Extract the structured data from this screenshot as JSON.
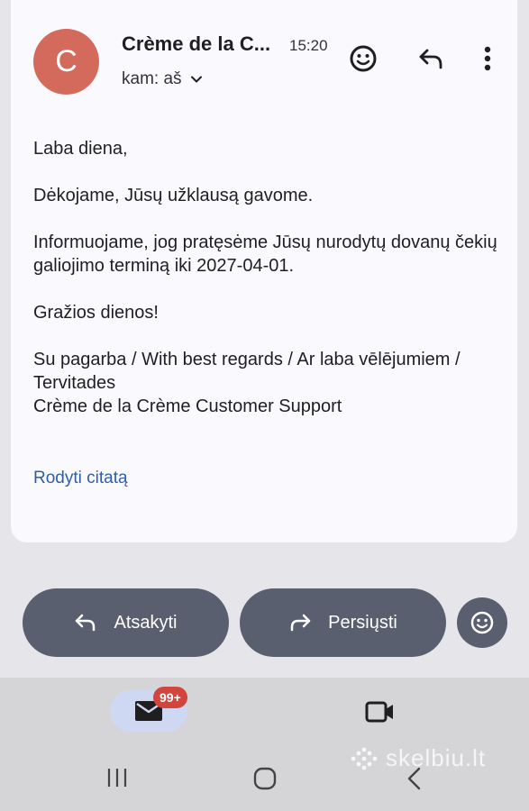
{
  "header": {
    "avatar_letter": "C",
    "sender": "Crème de la C...",
    "time": "15:20",
    "recipient": "kam: aš",
    "icons": [
      "add-reaction-icon",
      "reply-icon",
      "more-vert-icon",
      "chevron-down-icon"
    ]
  },
  "email": {
    "greeting": "Laba diena,",
    "line1": "Dėkojame, Jūsų užklausą gavome.",
    "line2": "Informuojame, jog pratęsėme Jūsų nurodytų dovanų čekių galiojimo terminą iki 2027-04-01.",
    "line3": "Gražios dienos!",
    "signature1": "Su pagarba / With best regards / Ar laba vēlējumiem / Tervitades",
    "signature2": "Crème de la Crème Customer Support",
    "show_quote": "Rodyti citatą"
  },
  "actions": {
    "reply": "Atsakyti",
    "forward": "Persiųsti"
  },
  "bottom_nav": {
    "mail_badge": "99+",
    "watermark": "skelbiu.lt"
  },
  "colors": {
    "avatar": "#d36a5c",
    "action_pill": "#5a5f70",
    "link": "#2f5ea8",
    "badge": "#d2453d"
  }
}
